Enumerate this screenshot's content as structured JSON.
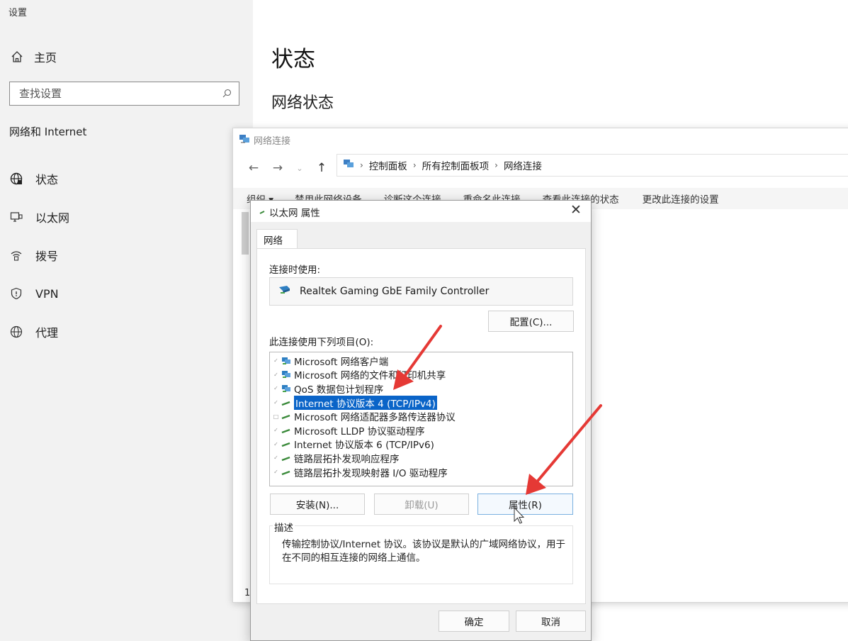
{
  "settings": {
    "window_title": "设置",
    "home_label": "主页",
    "search_placeholder": "查找设置",
    "section_label": "网络和 Internet",
    "nav": [
      {
        "label": "状态",
        "icon": "globe-status-icon"
      },
      {
        "label": "以太网",
        "icon": "ethernet-icon"
      },
      {
        "label": "拨号",
        "icon": "dialup-icon"
      },
      {
        "label": "VPN",
        "icon": "vpn-icon"
      },
      {
        "label": "代理",
        "icon": "globe-icon"
      }
    ],
    "page_title": "状态",
    "sub_title": "网络状态"
  },
  "explorer": {
    "title": "网络连接",
    "breadcrumb": [
      "控制面板",
      "所有控制面板项",
      "网络连接"
    ],
    "commands": [
      "组织 ▾",
      "禁用此网络设备",
      "诊断这个连接",
      "重命名此连接",
      "查看此连接的状态",
      "更改此连接的设置"
    ],
    "item_count": "1"
  },
  "dialog": {
    "title": "以太网 属性",
    "tab": "网络",
    "connect_using_label": "连接时使用:",
    "adapter_name": "Realtek Gaming GbE Family Controller",
    "configure_button": "配置(C)...",
    "items_label": "此连接使用下列项目(O):",
    "items": [
      {
        "label": "Microsoft 网络客户端",
        "checked": true,
        "icon": "network-client-icon",
        "selected": false
      },
      {
        "label": "Microsoft 网络的文件和打印机共享",
        "checked": true,
        "icon": "network-client-icon",
        "selected": false
      },
      {
        "label": "QoS 数据包计划程序",
        "checked": true,
        "icon": "network-client-icon",
        "selected": false
      },
      {
        "label": "Internet 协议版本 4 (TCP/IPv4)",
        "checked": true,
        "icon": "protocol-icon",
        "selected": true
      },
      {
        "label": "Microsoft 网络适配器多路传送器协议",
        "checked": false,
        "icon": "protocol-icon",
        "selected": false
      },
      {
        "label": "Microsoft LLDP 协议驱动程序",
        "checked": true,
        "icon": "protocol-icon",
        "selected": false
      },
      {
        "label": "Internet 协议版本 6 (TCP/IPv6)",
        "checked": true,
        "icon": "protocol-icon",
        "selected": false
      },
      {
        "label": "链路层拓扑发现响应程序",
        "checked": true,
        "icon": "protocol-icon",
        "selected": false
      },
      {
        "label": "链路层拓扑发现映射器 I/O 驱动程序",
        "checked": true,
        "icon": "protocol-icon",
        "selected": false
      }
    ],
    "install_button": "安装(N)...",
    "uninstall_button": "卸载(U)",
    "properties_button": "属性(R)",
    "description_legend": "描述",
    "description_text": "传输控制协议/Internet 协议。该协议是默认的广域网络协议，用于在不同的相互连接的网络上通信。",
    "ok_button": "确定",
    "cancel_button": "取消",
    "close_glyph": "✕"
  },
  "colors": {
    "selection": "#0a64c8",
    "arrow": "#e53935",
    "sidebar_bg": "#f2f2f2"
  }
}
